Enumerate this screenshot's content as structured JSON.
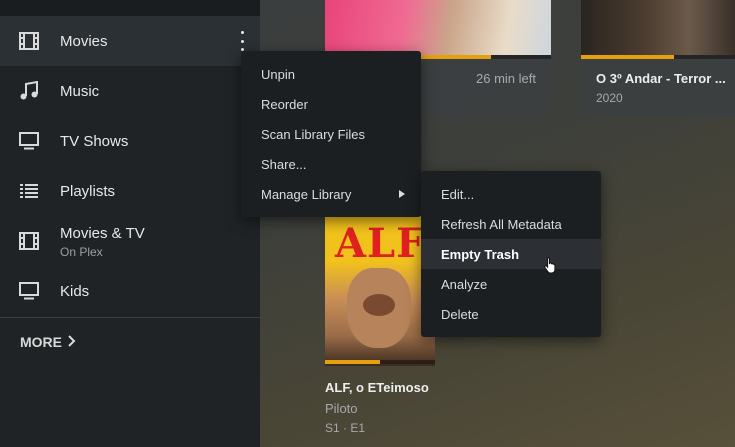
{
  "sidebar": {
    "items": [
      {
        "label": "Movies",
        "icon": "film-icon",
        "active": true
      },
      {
        "label": "Music",
        "icon": "music-note-icon"
      },
      {
        "label": "TV Shows",
        "icon": "monitor-icon"
      },
      {
        "label": "Playlists",
        "icon": "list-icon"
      },
      {
        "label": "Movies & TV",
        "sub": "On Plex",
        "icon": "film-icon"
      },
      {
        "label": "Kids",
        "icon": "monitor-icon"
      }
    ],
    "more_label": "MORE"
  },
  "library_menu": {
    "items": [
      "Unpin",
      "Reorder",
      "Scan Library Files",
      "Share...",
      "Manage Library"
    ]
  },
  "manage_submenu": {
    "items": [
      "Edit...",
      "Refresh All Metadata",
      "Empty Trash",
      "Analyze",
      "Delete"
    ],
    "hovered": "Empty Trash"
  },
  "cards": {
    "card1": {
      "time_left": "26 min left",
      "progress": 0.6
    },
    "card2": {
      "title": "O 3º Andar - Terror ...",
      "year": "2020",
      "progress": 0.55
    },
    "card3": {
      "title": "ALF, o ETeimoso",
      "subtitle": "Piloto",
      "episode": "S1 · E1",
      "poster_text": "ALF",
      "progress": 0.5
    }
  },
  "colors": {
    "accent": "#e5a00d",
    "sidebar_bg": "#1f2326",
    "menu_bg": "#1c1f22"
  }
}
